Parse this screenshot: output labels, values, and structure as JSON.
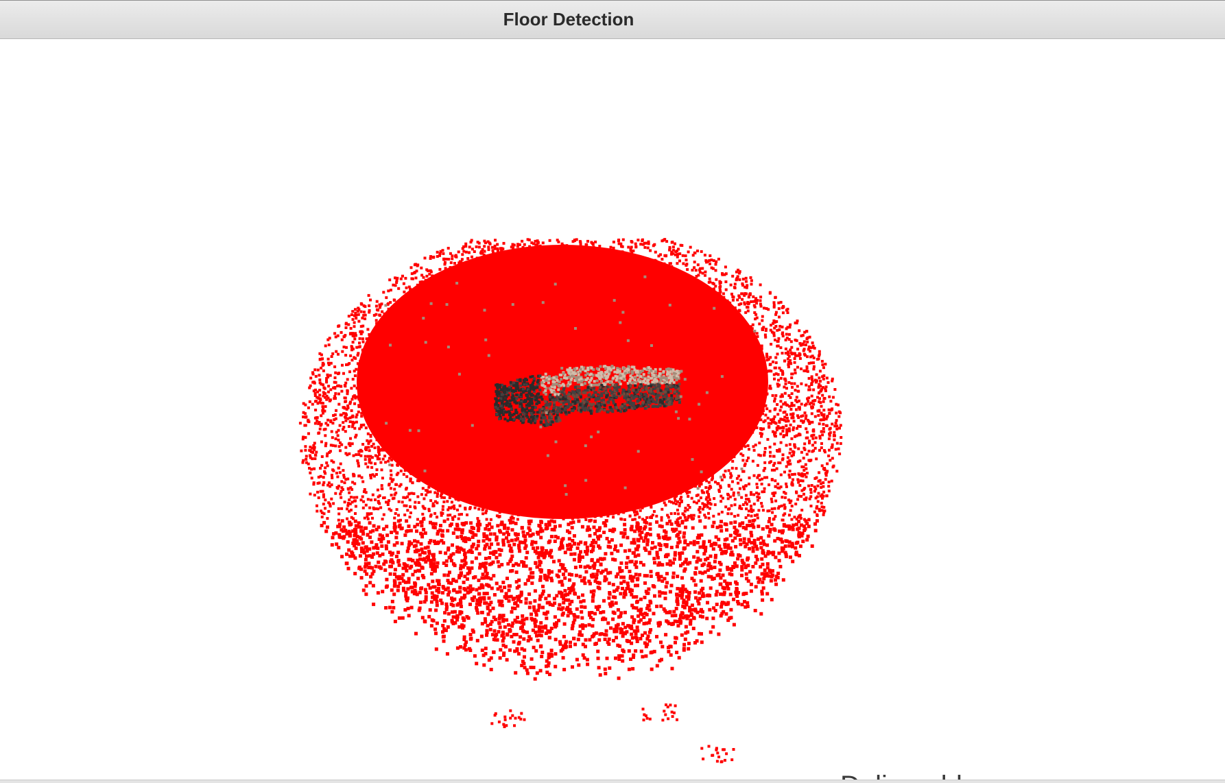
{
  "window": {
    "title": "Floor Detection"
  },
  "viewer": {
    "floor_point_color": "#ff0000",
    "object_colors": [
      "#2b2b2b",
      "#444040",
      "#6e4a3c",
      "#a58c7a",
      "#d2bcaa"
    ],
    "background_color": "#ffffff"
  },
  "bottom_clipped_text": "Deliverables"
}
